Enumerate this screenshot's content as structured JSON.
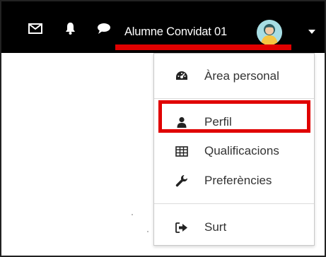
{
  "navbar": {
    "icons": [
      "mail-icon",
      "bell-icon",
      "chat-bubble-icon"
    ],
    "username": "Alumne Convidat 01",
    "avatar": "avatar-icon",
    "caret": "caret-down-icon",
    "background": "#000000"
  },
  "dropdown": {
    "items": [
      {
        "label": "Àrea personal",
        "icon": "dashboard-icon"
      },
      {
        "label": "Perfil",
        "icon": "user-icon"
      },
      {
        "label": "Qualificacions",
        "icon": "table-icon"
      },
      {
        "label": "Preferències",
        "icon": "wrench-icon"
      },
      {
        "label": "Surt",
        "icon": "sign-out-icon"
      }
    ]
  },
  "annotations": {
    "highlight_color": "#e00000",
    "highlighted_item": "Perfil"
  }
}
